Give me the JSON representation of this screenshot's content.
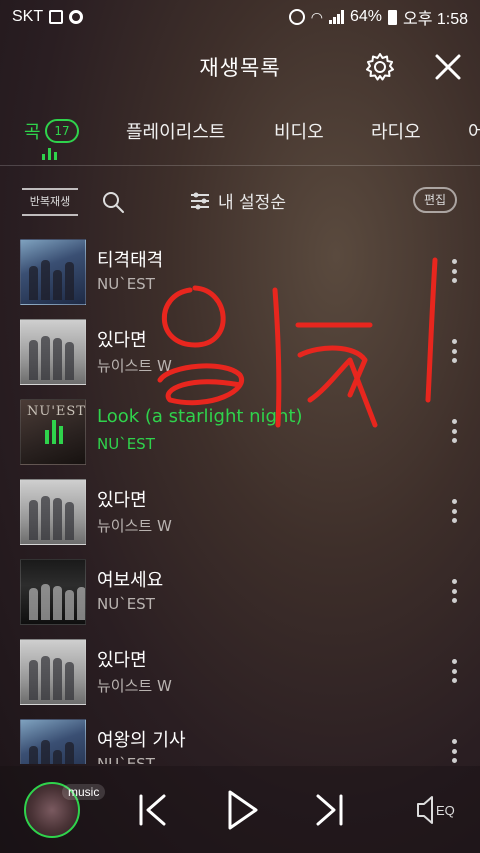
{
  "status_bar": {
    "carrier": "SKT",
    "battery": "64%",
    "time": "오후 1:58"
  },
  "header": {
    "title": "재생목록",
    "settings_icon": "gear-icon",
    "close_icon": "close-icon"
  },
  "tabs": [
    {
      "label": "곡",
      "count": "17",
      "active": true
    },
    {
      "label": "플레이리스트"
    },
    {
      "label": "비디오"
    },
    {
      "label": "라디오"
    },
    {
      "label": "어"
    }
  ],
  "toolbar": {
    "repeat_label": "반복재생",
    "sort_label": "내 설정순",
    "edit_label": "편집"
  },
  "songs": [
    {
      "title": "티격태격",
      "artist": "NU`EST",
      "art": "blue"
    },
    {
      "title": "있다면",
      "artist": "뉴이스트 W",
      "art": "grey"
    },
    {
      "title": "Look (a starlight night)",
      "artist": "NU`EST",
      "art": "dark",
      "playing": true
    },
    {
      "title": "있다면",
      "artist": "뉴이스트 W",
      "art": "grey"
    },
    {
      "title": "여보세요",
      "artist": "NU`EST",
      "art": "night"
    },
    {
      "title": "있다면",
      "artist": "뉴이스트 W",
      "art": "grey"
    },
    {
      "title": "여왕의 기사",
      "artist": "NU`EST",
      "art": "blue"
    }
  ],
  "player": {
    "badge": "music",
    "eq_label": "EQ"
  },
  "colors": {
    "accent": "#2fd34c",
    "annotation": "#e8261e"
  }
}
